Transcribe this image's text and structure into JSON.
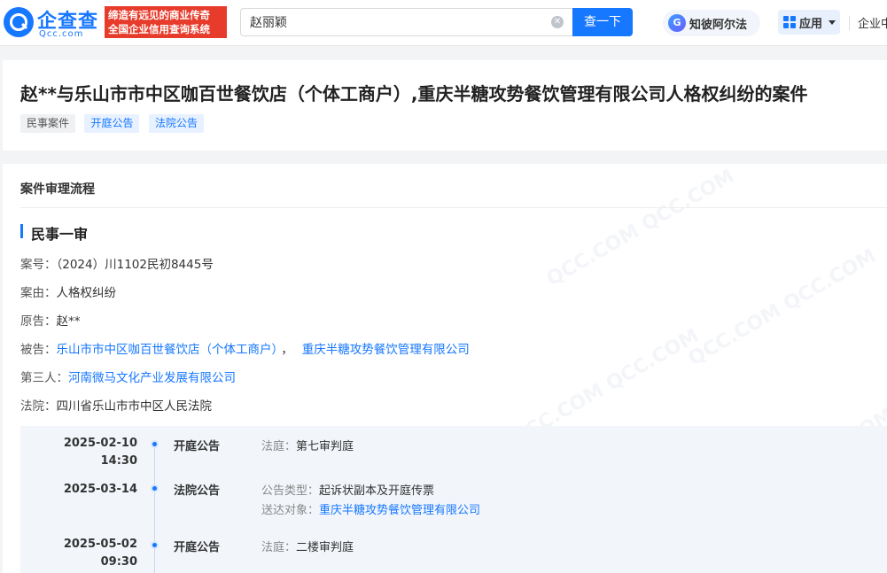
{
  "header": {
    "logo_name": "企查查",
    "logo_domain": "Qcc.com",
    "slogan_line1": "缔造有远见的商业传奇",
    "slogan_line2": "全国企业信用查询系统",
    "search_value": "赵丽颖",
    "search_button": "查一下",
    "zhibi_label": "知彼阿尔法",
    "apps_label": "应用",
    "enterprise_label": "企业中"
  },
  "case": {
    "title": "赵**与乐山市市中区咖百世餐饮店（个体工商户）,重庆半糖攻势餐饮管理有限公司人格权纠纷的案件",
    "tags": [
      "民事案件",
      "开庭公告",
      "法院公告"
    ]
  },
  "process": {
    "section_title": "案件审理流程",
    "stage_title": "民事一审",
    "case_no_label": "案号：",
    "case_no": "（2024）川1102民初8445号",
    "cause_label": "案由：",
    "cause": "人格权纠纷",
    "plaintiff_label": "原告：",
    "plaintiff": "赵**",
    "defendant_label": "被告：",
    "defendants": [
      "乐山市市中区咖百世餐饮店（个体工商户）",
      "重庆半糖攻势餐饮管理有限公司"
    ],
    "defendant_separator": "，",
    "third_party_label": "第三人：",
    "third_party": "河南微马文化产业发展有限公司",
    "court_label": "法院：",
    "court": "四川省乐山市市中区人民法院"
  },
  "timeline": [
    {
      "date": "2025-02-10",
      "time": "14:30",
      "type": "开庭公告",
      "details": [
        {
          "label": "法庭：",
          "value": "第七审判庭",
          "link": false
        }
      ]
    },
    {
      "date": "2025-03-14",
      "time": "",
      "type": "法院公告",
      "details": [
        {
          "label": "公告类型：",
          "value": "起诉状副本及开庭传票",
          "link": false
        },
        {
          "label": "送达对象：",
          "value": "重庆半糖攻势餐饮管理有限公司",
          "link": true
        }
      ]
    },
    {
      "date": "2025-05-02",
      "time": "09:30",
      "type": "开庭公告",
      "details": [
        {
          "label": "法庭：",
          "value": "二楼审判庭",
          "link": false
        }
      ]
    }
  ],
  "colors": {
    "accent": "#1677ff",
    "slogan_bg": "#e73c2c"
  }
}
